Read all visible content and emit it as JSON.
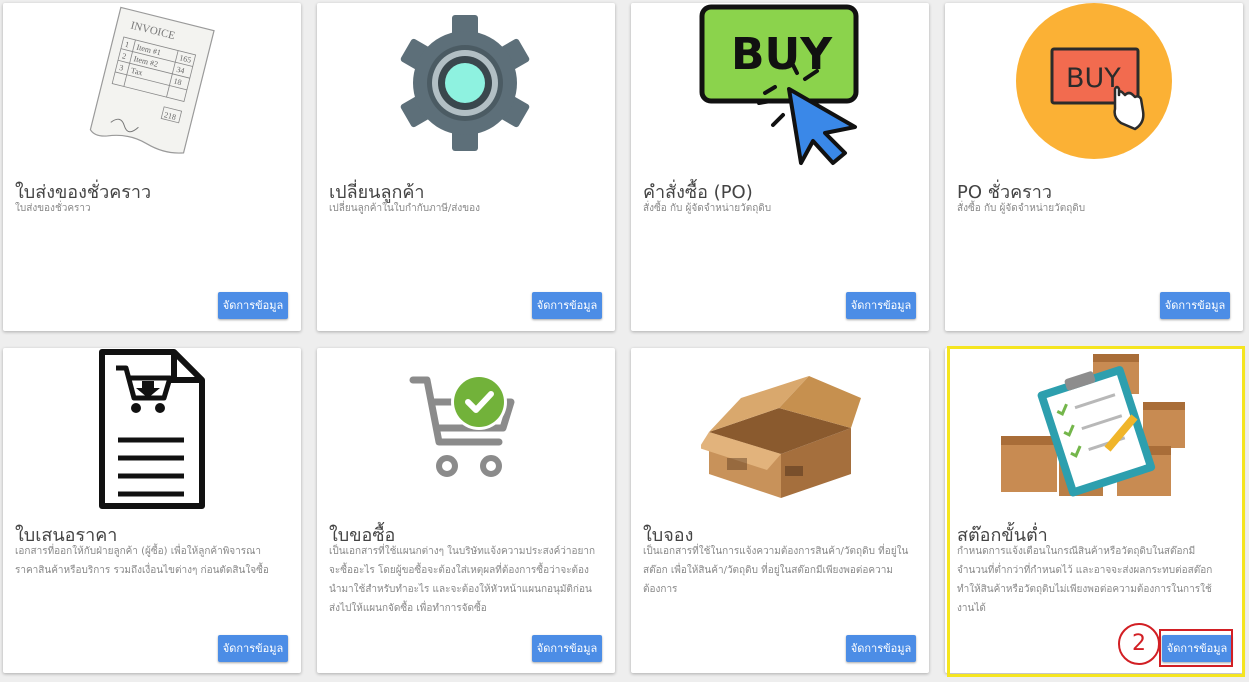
{
  "cards": [
    {
      "title": "ใบส่งของชั่วคราว",
      "desc": "ใบส่งของชั่วคราว",
      "button": "จัดการข้อมูล",
      "icon": "invoice-icon",
      "invoice_text": {
        "header": "INVOICE",
        "rows": [
          [
            "1",
            "Item #1",
            "165"
          ],
          [
            "2",
            "Item #2",
            "34"
          ],
          [
            "3",
            "Tax",
            "18"
          ]
        ],
        "total": "218"
      }
    },
    {
      "title": "เปลี่ยนลูกค้า",
      "desc": "เปลี่ยนลูกค้าในใบกำกับภาษี/ส่งของ",
      "button": "จัดการข้อมูล",
      "icon": "gear-icon"
    },
    {
      "title": "คำสั่งซื้อ (PO)",
      "desc": "สั่งซื้อ กับ ผู้จัดจำหน่ายวัตถุดิบ",
      "button": "จัดการข้อมูล",
      "icon": "buy-click-icon",
      "badge_text": "BUY"
    },
    {
      "title": "PO ชั่วคราว",
      "desc": "สั่งซื้อ กับ ผู้จัดจำหน่ายวัตถุดิบ",
      "button": "จัดการข้อมูล",
      "icon": "buy-circle-icon",
      "badge_text": "BUY"
    },
    {
      "title": "ใบเสนอราคา",
      "desc": "เอกสารที่ออกให้กับฝ่ายลูกค้า (ผู้ซื้อ) เพื่อให้ลูกค้าพิจารณาราคาสินค้าหรือบริการ รวมถึงเงื่อนไขต่างๆ ก่อนตัดสินใจซื้อ",
      "button": "จัดการข้อมูล",
      "icon": "quotation-document-icon"
    },
    {
      "title": "ใบขอซื้อ",
      "desc": "เป็นเอกสารที่ใช้แผนกต่างๆ ในบริษัทแจ้งความประสงค์ว่าอยากจะซื้ออะไร โดยผู้ขอซื้อจะต้องใส่เหตุผลที่ต้องการซื้อว่าจะต้องนำมาใช้สำหรับทำอะไร และจะต้องให้หัวหน้าแผนกอนุมัติก่อนส่งไปให้แผนกจัดซื้อ เพื่อทำการจัดซื้อ",
      "button": "จัดการข้อมูล",
      "icon": "cart-check-icon"
    },
    {
      "title": "ใบจอง",
      "desc": "เป็นเอกสารที่ใช้ในการแจ้งความต้องการสินค้า/วัตถุดิบ ที่อยู่ในสต๊อก เพื่อให้สินค้า/วัตถุดิบ ที่อยู่ในสต๊อกมีเพียงพอต่อความต้องการ",
      "button": "จัดการข้อมูล",
      "icon": "box-icon"
    },
    {
      "title": "สต๊อกขั้นต่ำ",
      "desc": "กำหนดการแจ้งเตือนในกรณีสินค้าหรือวัตถุดิบในสต๊อกมีจำนวนที่ต่ำกว่าที่กำหนดไว้ และอาจจะส่งผลกระทบต่อสต๊อกทำให้สินค้าหรือวัตถุดิบไม่เพียงพอต่อความต้องการในการใช้งานได้",
      "button": "จัดการข้อมูล",
      "icon": "stock-clipboard-icon"
    }
  ],
  "annotation": {
    "step": "2"
  },
  "colors": {
    "button": "#4c8de6",
    "highlight": "#f5e520",
    "marker": "#d21f24"
  }
}
